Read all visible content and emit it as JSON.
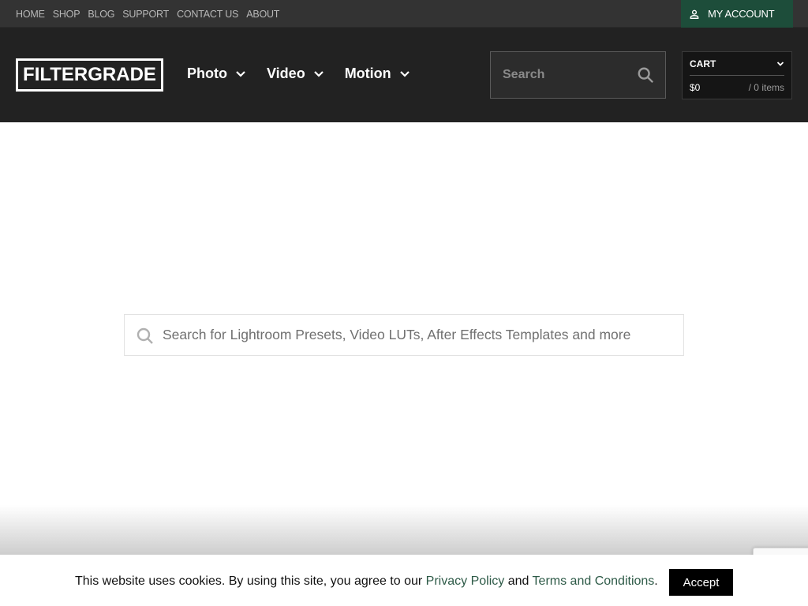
{
  "topbar": {
    "links": [
      "HOME",
      "SHOP",
      "BLOG",
      "SUPPORT",
      "CONTACT US",
      "ABOUT"
    ],
    "account_label": "MY ACCOUNT",
    "account_icon": "user-icon"
  },
  "header": {
    "logo": "FILTERGRADE",
    "nav": [
      {
        "label": "Photo",
        "icon": "chevron-down-icon"
      },
      {
        "label": "Video",
        "icon": "chevron-down-icon"
      },
      {
        "label": "Motion",
        "icon": "chevron-down-icon"
      }
    ],
    "search_placeholder": "Search",
    "search_icon": "search-icon",
    "cart": {
      "label": "CART",
      "total": "$0",
      "items": "/ 0 items"
    }
  },
  "main": {
    "search_placeholder": "Search for Lightroom Presets, Video LUTs, After Effects Templates and more"
  },
  "cookie_banner": {
    "text_before": "This website uses cookies. By using this site, you agree to our ",
    "privacy_link": "Privacy Policy",
    "text_mid": " and ",
    "terms_link": "Terms and Conditions",
    "text_after": ".",
    "accept_label": "Accept"
  },
  "colors": {
    "topbar_bg": "#333333",
    "header_bg": "#222222",
    "account_bg": "#1d4d3a",
    "link_green": "#2d5a47"
  }
}
